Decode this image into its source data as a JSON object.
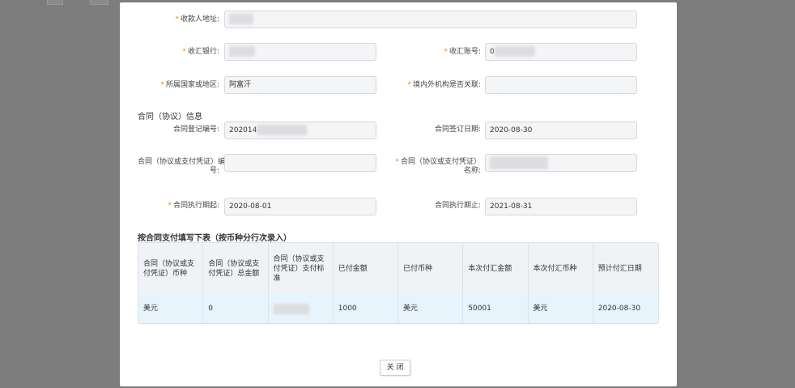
{
  "form": {
    "payee_address": {
      "label": "收款人地址:",
      "required": true,
      "value": ""
    },
    "bank": {
      "label": "收汇银行:",
      "required": true,
      "value": ""
    },
    "account": {
      "label": "收汇账号:",
      "required": true,
      "value": "0"
    },
    "country": {
      "label": "所属国家或地区:",
      "required": true,
      "value": "阿富汗"
    },
    "related": {
      "label": "境内外机构是否关联:",
      "required": true,
      "value": ""
    }
  },
  "contract": {
    "section_title": "合同（协议）信息",
    "reg_no": {
      "label": "合同登记编号:",
      "value": "202014"
    },
    "sign_date": {
      "label": "合同签订日期:",
      "value": "2020-08-30"
    },
    "voucher_no": {
      "label_line1": "合同（协议或支付凭证）编",
      "label_line2": "号:",
      "value": ""
    },
    "voucher_name": {
      "label_line1": "合同（协议或支付凭证）",
      "label_line2": "名称:",
      "required": true,
      "value": ""
    },
    "start_date": {
      "label": "合同执行期起:",
      "required": true,
      "value": "2020-08-01"
    },
    "end_date": {
      "label": "合同执行期止:",
      "value": "2021-08-31"
    }
  },
  "table": {
    "title": "按合同支付填写下表（按币种分行次录入）",
    "headers": [
      "合同（协议或支付凭证）币种",
      "合同（协议或支付凭证）总金额",
      "合同（协议或支付凭证）支付标准",
      "已付金额",
      "已付币种",
      "本次付汇金额",
      "本次付汇币种",
      "预计付汇日期"
    ],
    "rows": [
      [
        "美元",
        "0",
        "",
        "1000",
        "美元",
        "50001",
        "美元",
        "2020-08-30"
      ]
    ]
  },
  "buttons": {
    "close": "关 闭"
  },
  "colors": {
    "required": "#f08c1e",
    "input_bg": "#f4f5f7",
    "row_highlight": "#e8f4fc"
  }
}
